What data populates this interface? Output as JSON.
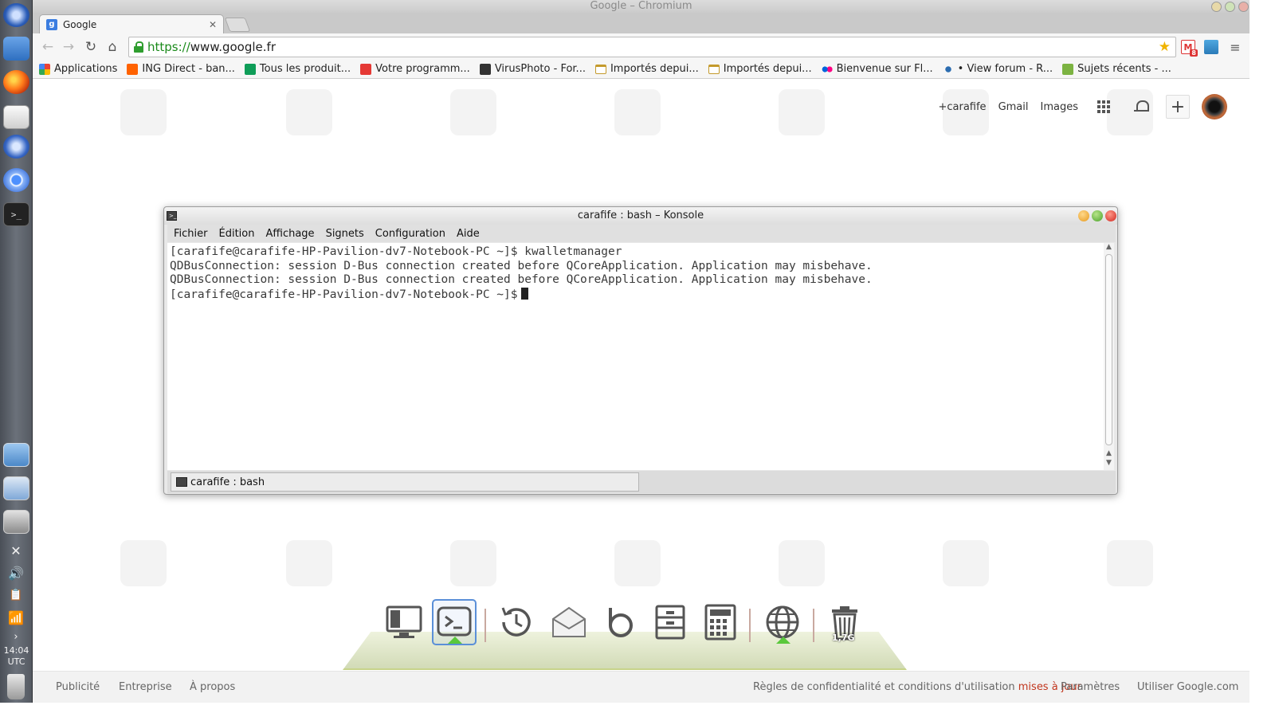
{
  "window": {
    "title": "Google – Chromium"
  },
  "browser": {
    "tab": {
      "title": "Google",
      "favicon_letter": "g"
    },
    "url_prefix": "https://",
    "url_rest": "www.google.fr",
    "extension_badge": "8",
    "bookmarks": [
      {
        "label": "Applications",
        "icon_color": "#e94235"
      },
      {
        "label": "ING Direct - ban...",
        "icon_color": "#ff6200"
      },
      {
        "label": "Tous les produit...",
        "icon_color": "#0f9d58"
      },
      {
        "label": "Votre programm...",
        "icon_color": "#e53935"
      },
      {
        "label": "VirusPhoto - For...",
        "icon_color": "#333333"
      },
      {
        "label": "Importés depui...",
        "icon_color": "folder"
      },
      {
        "label": "Importés depui...",
        "icon_color": "folder"
      },
      {
        "label": "Bienvenue sur Fl...",
        "icon_color": "#ff0084"
      },
      {
        "label": "• View forum - R...",
        "icon_color": "#2b6cb0"
      },
      {
        "label": "Sujets récents - ...",
        "icon_color": "#7cb342"
      }
    ]
  },
  "google": {
    "nav": {
      "user": "+carafife",
      "gmail": "Gmail",
      "images": "Images"
    },
    "footer": {
      "ads": "Publicité",
      "business": "Entreprise",
      "about": "À propos",
      "privacy_prefix": "Règles de confidentialité et conditions d'utilisation ",
      "privacy_link": "mises à jour",
      "settings": "Paramètres",
      "use_google": "Utiliser Google.com"
    }
  },
  "konsole": {
    "title": "carafife : bash – Konsole",
    "menu": [
      "Fichier",
      "Édition",
      "Affichage",
      "Signets",
      "Configuration",
      "Aide"
    ],
    "lines": [
      "[carafife@carafife-HP-Pavilion-dv7-Notebook-PC ~]$ kwalletmanager",
      "QDBusConnection: session D-Bus connection created before QCoreApplication. Application may misbehave.",
      "QDBusConnection: session D-Bus connection created before QCoreApplication. Application may misbehave.",
      "[carafife@carafife-HP-Pavilion-dv7-Notebook-PC ~]$"
    ],
    "tab_label": "carafife : bash"
  },
  "system": {
    "time": "14:04",
    "timezone": "UTC"
  },
  "dock": {
    "trash_label": "1,7G"
  },
  "colors": {
    "accent": "#5a8fd8",
    "running": "#5ac83c",
    "link_red": "#c1351d"
  }
}
